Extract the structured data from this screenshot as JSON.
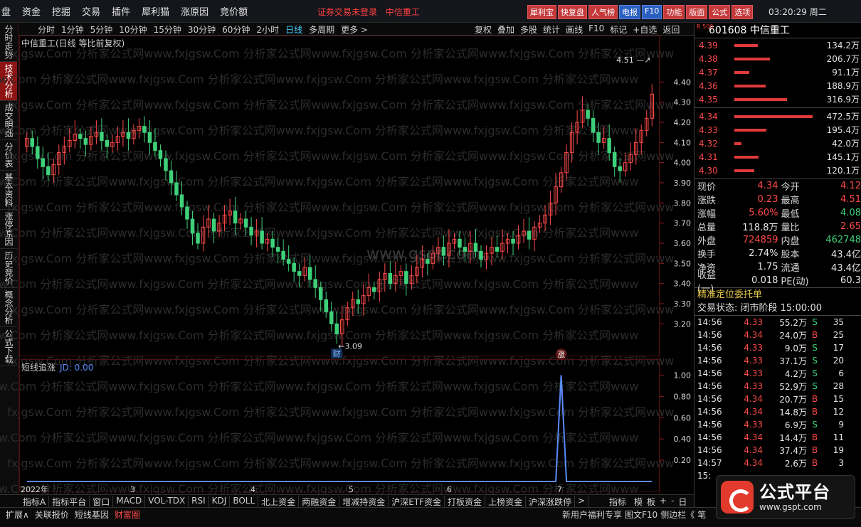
{
  "topbar": {
    "menus": [
      "盘",
      "资金",
      "挖掘",
      "交易",
      "插件",
      "犀利猫",
      "涨原因",
      "竞价额"
    ],
    "notice": "证券交易未登录",
    "stock_name": "中信重工",
    "buttons": [
      "犀利宝",
      "快复盘",
      "人气榜",
      "电报",
      "F10",
      "功能",
      "版面",
      "公式",
      "选项"
    ],
    "clock": "03:20:29 周二"
  },
  "leftnav": [
    "分时走势",
    "技术分析",
    "成交明细",
    "分价表",
    "基本资料",
    "涨停原因",
    "历史竞价",
    "概念分析",
    "公式下载"
  ],
  "timeframes": [
    "分时",
    "1分钟",
    "5分钟",
    "10分钟",
    "15分钟",
    "30分钟",
    "60分钟",
    "2小时",
    "日线",
    "多周期",
    "更多 >"
  ],
  "active_timeframe": "日线",
  "chart_tools": [
    "复权",
    "叠加",
    "多股",
    "统计",
    "画线",
    "F10",
    "标记",
    "+自选",
    "返回"
  ],
  "chart_title": "中信重工(日线 等比前复权)",
  "sub_indicator": {
    "name": "短线追涨",
    "jd": "JD: 0.00"
  },
  "watermarks": [
    "fxjgsw.Com 分析家公式网www.fxjgsw.Com 分析家公式网www.fxjgsw.Com 分析家公式网www.fxjgsw.Com 分析家公式网www",
    "www.gspt.com"
  ],
  "chart_data": [
    {
      "type": "candlestick",
      "title": "中信重工(日线 等比前复权)",
      "y_ticks": [
        4.4,
        4.3,
        4.2,
        4.1,
        4.0,
        3.9,
        3.8,
        3.7,
        3.6,
        3.5,
        3.4,
        3.3,
        3.2
      ],
      "ylim": [
        3.06,
        4.56
      ],
      "x_labels": [
        "2022年",
        "3",
        "4",
        "5",
        "6",
        "7"
      ],
      "annotations": {
        "max": "4.51",
        "min": "3.09",
        "marker_cai": "财",
        "marker_zhang": "涨"
      },
      "closes": [
        4.12,
        4.08,
        4.02,
        3.98,
        3.94,
        3.99,
        4.05,
        4.08,
        4.11,
        4.14,
        4.12,
        4.09,
        4.13,
        4.15,
        4.11,
        4.08,
        4.1,
        4.13,
        4.15,
        4.12,
        4.16,
        4.18,
        4.15,
        4.1,
        4.06,
        4.02,
        3.96,
        3.9,
        3.84,
        3.78,
        3.72,
        3.65,
        3.6,
        3.68,
        3.72,
        3.66,
        3.7,
        3.74,
        3.76,
        3.7,
        3.72,
        3.68,
        3.64,
        3.66,
        3.6,
        3.62,
        3.58,
        3.56,
        3.52,
        3.5,
        3.46,
        3.44,
        3.48,
        3.42,
        3.38,
        3.32,
        3.26,
        3.2,
        3.15,
        3.22,
        3.28,
        3.32,
        3.3,
        3.34,
        3.38,
        3.36,
        3.42,
        3.45,
        3.4,
        3.44,
        3.46,
        3.4,
        3.44,
        3.48,
        3.52,
        3.5,
        3.55,
        3.58,
        3.54,
        3.6,
        3.62,
        3.58,
        3.56,
        3.6,
        3.56,
        3.52,
        3.55,
        3.58,
        3.56,
        3.6,
        3.62,
        3.6,
        3.64,
        3.66,
        3.62,
        3.68,
        3.7,
        3.74,
        3.8,
        3.88,
        3.95,
        4.05,
        4.15,
        4.2,
        4.26,
        4.22,
        4.15,
        4.1,
        4.12,
        4.05,
        3.98,
        3.96,
        4.0,
        4.04,
        4.1,
        4.16,
        4.22,
        4.34
      ],
      "opens": [
        4.08,
        4.12,
        4.08,
        4.02,
        3.98,
        3.94,
        3.99,
        4.05,
        4.08,
        4.11,
        4.14,
        4.12,
        4.09,
        4.13,
        4.15,
        4.11,
        4.08,
        4.1,
        4.13,
        4.15,
        4.12,
        4.16,
        4.18,
        4.15,
        4.1,
        4.06,
        4.02,
        3.96,
        3.9,
        3.84,
        3.78,
        3.72,
        3.65,
        3.6,
        3.68,
        3.72,
        3.66,
        3.7,
        3.74,
        3.76,
        3.7,
        3.72,
        3.68,
        3.64,
        3.66,
        3.6,
        3.62,
        3.58,
        3.56,
        3.52,
        3.5,
        3.46,
        3.44,
        3.48,
        3.42,
        3.38,
        3.32,
        3.26,
        3.2,
        3.15,
        3.22,
        3.28,
        3.32,
        3.3,
        3.34,
        3.38,
        3.36,
        3.42,
        3.45,
        3.4,
        3.44,
        3.46,
        3.4,
        3.44,
        3.48,
        3.52,
        3.5,
        3.55,
        3.58,
        3.54,
        3.6,
        3.62,
        3.58,
        3.56,
        3.6,
        3.56,
        3.52,
        3.55,
        3.58,
        3.56,
        3.6,
        3.62,
        3.6,
        3.64,
        3.66,
        3.62,
        3.68,
        3.7,
        3.74,
        3.8,
        3.88,
        3.95,
        4.05,
        4.15,
        4.2,
        4.26,
        4.22,
        4.15,
        4.1,
        4.12,
        4.05,
        3.98,
        3.96,
        4.0,
        4.04,
        4.1,
        4.16,
        4.22
      ]
    },
    {
      "type": "line",
      "title": "短线追涨",
      "y_ticks": [
        1.0,
        0.8,
        0.6,
        0.4,
        0.2
      ],
      "ylim": [
        0,
        1.05
      ],
      "values_nonzero": {
        "index": 100,
        "value": 1.0
      }
    }
  ],
  "bottom_tabs": [
    "指标A",
    "指标平台",
    "窗口",
    "MACD",
    "VOL-TDX",
    "RSI",
    "KDJ",
    "BOLL",
    "北上资金",
    "两融资金",
    "增减持资金",
    "沪深ETF资金",
    "打板资金",
    "上榜资金",
    "沪深涨跌停",
    ">"
  ],
  "bottom_right_tabs": [
    "指标B",
    "模",
    "板",
    "+",
    "-",
    "日线"
  ],
  "footer_tabs": [
    "扩展∧",
    "关联报价",
    "短线基因",
    "财富圈"
  ],
  "footer_active": "财富圈",
  "footer_right": [
    "新用户福利专享",
    "图文F10",
    "侧边栏《",
    "笔"
  ],
  "rpanel": {
    "r500": "R 500",
    "code": "601608",
    "name": "中信重工",
    "asks": [
      {
        "price": "4.39",
        "vol": "134.2万",
        "bar": 0.3
      },
      {
        "price": "4.38",
        "vol": "206.7万",
        "bar": 0.45
      },
      {
        "price": "4.37",
        "vol": "91.1万",
        "bar": 0.19
      },
      {
        "price": "4.36",
        "vol": "188.9万",
        "bar": 0.4
      },
      {
        "price": "4.35",
        "vol": "316.9万",
        "bar": 0.67
      }
    ],
    "bids": [
      {
        "price": "4.34",
        "vol": "472.5万",
        "bar": 1.0
      },
      {
        "price": "4.33",
        "vol": "195.4万",
        "bar": 0.41
      },
      {
        "price": "4.32",
        "vol": "42.0万",
        "bar": 0.09
      },
      {
        "price": "4.31",
        "vol": "145.1万",
        "bar": 0.31
      },
      {
        "price": "4.30",
        "vol": "120.1万",
        "bar": 0.25
      }
    ],
    "quote": [
      {
        "l1": "现价",
        "v1": "4.34",
        "c1": "red",
        "l2": "今开",
        "v2": "4.12",
        "c2": "red"
      },
      {
        "l1": "涨跌",
        "v1": "0.23",
        "c1": "red",
        "l2": "最高",
        "v2": "4.51",
        "c2": "red"
      },
      {
        "l1": "涨幅",
        "v1": "5.60%",
        "c1": "red",
        "l2": "最低",
        "v2": "4.08",
        "c2": "green"
      },
      {
        "l1": "总量",
        "v1": "118.8万",
        "c1": "white",
        "l2": "量比",
        "v2": "2.65",
        "c2": "red"
      },
      {
        "l1": "外盘",
        "v1": "724859",
        "c1": "red",
        "l2": "内盘",
        "v2": "462748",
        "c2": "green"
      },
      {
        "l1": "换手",
        "v1": "2.74%",
        "c1": "white",
        "l2": "股本",
        "v2": "43.4亿",
        "c2": "white"
      },
      {
        "l1": "净资",
        "v1": "1.75",
        "c1": "white",
        "l2": "流通",
        "v2": "43.4亿",
        "c2": "white"
      },
      {
        "l1": "收益(一)",
        "v1": "0.018",
        "c1": "white",
        "l2": "PE(动)",
        "v2": "60.3",
        "c2": "white"
      }
    ],
    "dpo": "精准定位委托单",
    "trade_state": "交易状态: 闭市阶段 15:00:00",
    "ticks": [
      {
        "t": "14:56",
        "p": "4.33",
        "pc": "red",
        "v": "55.2万",
        "s": "S",
        "n": "35"
      },
      {
        "t": "14:56",
        "p": "4.34",
        "pc": "red",
        "v": "24.0万",
        "s": "B",
        "n": "25"
      },
      {
        "t": "14:56",
        "p": "4.33",
        "pc": "red",
        "v": "9.0万",
        "s": "S",
        "n": "17"
      },
      {
        "t": "14:56",
        "p": "4.33",
        "pc": "red",
        "v": "37.1万",
        "s": "S",
        "n": "20"
      },
      {
        "t": "14:56",
        "p": "4.33",
        "pc": "red",
        "v": "4.2万",
        "s": "S",
        "n": "6"
      },
      {
        "t": "14:56",
        "p": "4.33",
        "pc": "red",
        "v": "52.9万",
        "s": "S",
        "n": "28"
      },
      {
        "t": "14:56",
        "p": "4.34",
        "pc": "red",
        "v": "20.7万",
        "s": "B",
        "n": "15"
      },
      {
        "t": "14:56",
        "p": "4.34",
        "pc": "red",
        "v": "14.8万",
        "s": "B",
        "n": "12"
      },
      {
        "t": "14:56",
        "p": "4.33",
        "pc": "red",
        "v": "6.9万",
        "s": "S",
        "n": "9"
      },
      {
        "t": "14:56",
        "p": "4.34",
        "pc": "red",
        "v": "14.4万",
        "s": "B",
        "n": "11"
      },
      {
        "t": "14:56",
        "p": "4.34",
        "pc": "red",
        "v": "37.4万",
        "s": "B",
        "n": "19"
      },
      {
        "t": "14:57",
        "p": "4.34",
        "pc": "red",
        "v": "2.6万",
        "s": "B",
        "n": "3"
      }
    ],
    "last_tick_time": "15:",
    "colors": {
      "up": "#ff4a4a",
      "down": "#3fd17a",
      "line": "#5a8cff"
    }
  },
  "logo": {
    "title": "公式平台",
    "url": "www.gspt.com"
  }
}
